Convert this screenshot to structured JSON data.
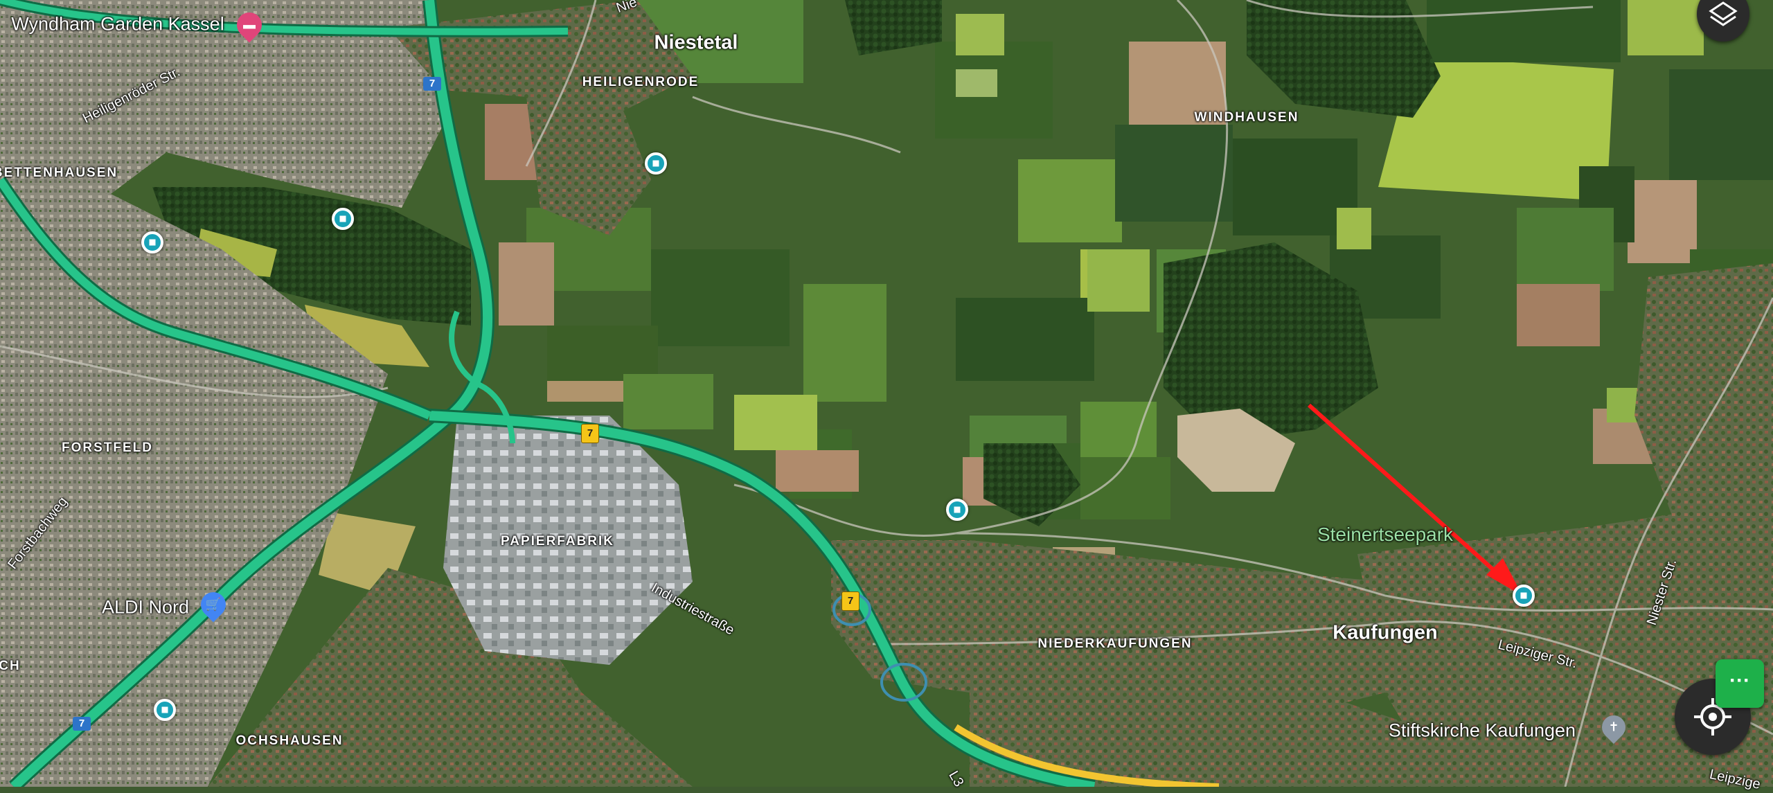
{
  "map": {
    "labels": {
      "hotel": "Wyndham Garden Kassel",
      "niestetal": "Niestetal",
      "heiligenrode": "HEILIGENRODE",
      "windhausen": "WINDHAUSEN",
      "bettenhausen": "BETTENHAUSEN",
      "forstfeld": "FORSTFELD",
      "papierfabrik": "PAPIERFABRIK",
      "industriestrasse": "Industriestraße",
      "aldi": "ALDI Nord",
      "ochshausen": "OCHSHAUSEN",
      "niederkaufungen": "NIEDERKAUFUNGEN",
      "kaufungen": "Kaufungen",
      "steinertseepark": "Steinertseepark",
      "leipziger": "Leipziger Str.",
      "leipziger_edge": "Leipzige",
      "niester": "Niester Str.",
      "stiftskirche": "Stiftskirche Kaufungen",
      "heiligenroder": "Heiligenröder Str.",
      "forstbachweg": "Forstbachweg",
      "ch_edge": "CH",
      "ni_edge": "Nie",
      "la_edge": "L3"
    },
    "road_shields": {
      "a7_top": "7",
      "a7_mid": "7",
      "a7_lower": "7",
      "a7_left": "7"
    },
    "colors": {
      "highway": "#27c48a",
      "highway_edge": "#0f6b45",
      "secondary_road": "#f2c531",
      "pin": "#18a3b8",
      "arrow": "#ff1a1a",
      "fields_dark": "#2f5a24",
      "fields_light": "#8fbf3c"
    },
    "icons": {
      "layers": "layers-icon",
      "locate": "my-location-icon",
      "more": "more-options-icon"
    },
    "more_label": "···"
  }
}
